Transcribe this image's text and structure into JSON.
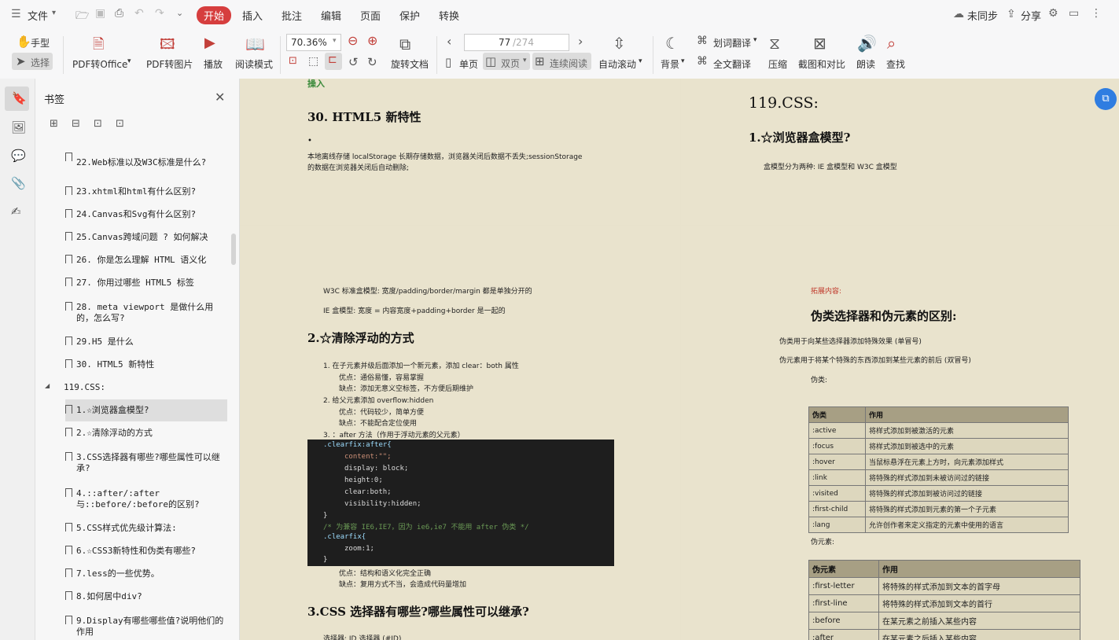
{
  "menubar": {
    "file": "文件",
    "tabs": [
      "开始",
      "插入",
      "批注",
      "编辑",
      "页面",
      "保护",
      "转换"
    ],
    "sync": "未同步",
    "share": "分享"
  },
  "ribbon": {
    "hand": "手型",
    "select": "选择",
    "pdf_office": "PDF转Office",
    "pdf_image": "PDF转图片",
    "play": "播放",
    "read_mode": "阅读模式",
    "zoom": "70.36%",
    "page_current": "77",
    "page_total": "/274",
    "rotate": "旋转文档",
    "single": "单页",
    "double": "双页",
    "continuous": "连续阅读",
    "autoscroll": "自动滚动",
    "background": "背景",
    "word_translate": "划词翻译",
    "full_translate": "全文翻译",
    "compress": "压缩",
    "screenshot": "截图和对比",
    "read_aloud": "朗读",
    "find": "查找"
  },
  "panel": {
    "title": "书签",
    "items": [
      {
        "label": "22.Web标准以及W3C标准是什么?"
      },
      {
        "label": "23.xhtml和html有什么区别?"
      },
      {
        "label": "24.Canvas和Svg有什么区别?"
      },
      {
        "label": "25.Canvas跨域问题 ? 如何解决"
      },
      {
        "label": "26. 你是怎么理解 HTML 语义化"
      },
      {
        "label": "27. 你用过哪些 HTML5 标签"
      },
      {
        "label": "28. meta viewport 是做什么用的，怎么写?"
      },
      {
        "label": "29.H5 是什么"
      },
      {
        "label": "30. HTML5 新特性"
      },
      {
        "label": "1.☆浏览器盒模型?"
      },
      {
        "label": "2.☆清除浮动的方式"
      },
      {
        "label": "3.CSS选择器有哪些?哪些属性可以继承?"
      },
      {
        "label": "4.::after/:after与::before/:before的区别?"
      },
      {
        "label": "5.CSS样式优先级计算法:"
      },
      {
        "label": "6.☆CSS3新特性和伪类有哪些?"
      },
      {
        "label": "7.less的一些优势。"
      },
      {
        "label": "8.如何居中div?"
      },
      {
        "label": "9.Display有哪些哪些值?说明他们的作用"
      }
    ],
    "section": "119.CSS:"
  },
  "doc": {
    "top_left": {
      "cut": "操入",
      "h30": "30.  HTML5  新特性",
      "bullet": "•",
      "line1": "本地离线存储  localStorage  长期存储数据，浏览器关闭后数据不丢失;sessionStorage",
      "line2": "的数据在浏览器关闭后自动删除;"
    },
    "top_right": {
      "h119": "119.CSS:",
      "h1": "1.☆浏览器盒模型?",
      "p": "盒模型分为两种: IE 盒模型和 W3C 盒模型"
    },
    "bottom_left": {
      "w3c": "W3C 标准盒模型:  宽度/padding/border/margin 都是单独分开的",
      "ie": "IE 盒模型:  宽度 = 内容宽度+padding+border  是一起的",
      "h2": "2.☆清除浮动的方式",
      "l1": "1. 在子元素并级后面添加一个新元素，添加 clear：both 属性",
      "l1a": "优点：通俗易懂，容易掌握",
      "l1b": "缺点：添加无意义空标签，不方便后期维护",
      "l2": "2. 给父元素添加 overflow:hidden",
      "l2a": "优点：代码较少，简单方便",
      "l2b": "缺点：不能配合定位使用",
      "l3": "3. ：after 方法（作用于浮动元素的父元素）",
      "code": [
        ".clearfix:after{",
        "content:\"\";",
        "display: block;",
        "height:0;",
        "clear:both;",
        "visibility:hidden;",
        "}",
        "/* 为兼容 IE6,IE7，因为 ie6,ie7 不能用 after 伪类 */",
        ".clearfix{",
        "zoom:1;",
        "}"
      ],
      "l3a": "优点：结构和语义化完全正确",
      "l3b": "缺点：复用方式不当，会造成代码量增加",
      "h3": "3.CSS 选择器有哪些?哪些属性可以继承?",
      "sel": "选择器: ID 选择器 (#ID)"
    },
    "bottom_right": {
      "extend": "拓展内容:",
      "h": "伪类选择器和伪元素的区别:",
      "p1": "伪类用于向某些选择器添加特殊效果 (单冒号)",
      "p2": "伪元素用于将某个特殊的东西添加到某些元素的前后 (双冒号)",
      "pseudo_class": "伪类:",
      "table1": {
        "headers": [
          "伪类",
          "作用"
        ],
        "rows": [
          [
            ":active",
            "将样式添加到被激活的元素"
          ],
          [
            ":focus",
            "将样式添加到被选中的元素"
          ],
          [
            ":hover",
            "当鼠标悬浮在元素上方时，向元素添加样式"
          ],
          [
            ":link",
            "将特殊的样式添加到未被访问过的链接"
          ],
          [
            ":visited",
            "将特殊的样式添加到被访问过的链接"
          ],
          [
            ":first-child",
            "将特殊的样式添加到元素的第一个子元素"
          ],
          [
            ":lang",
            "允许创作者来定义指定的元素中使用的语言"
          ]
        ]
      },
      "pseudo_element": "伪元素:",
      "table2": {
        "headers": [
          "伪元素",
          "作用"
        ],
        "rows": [
          [
            ":first-letter",
            "将特殊的样式添加到文本的首字母"
          ],
          [
            ":first-line",
            "将特殊的样式添加到文本的首行"
          ],
          [
            ":before",
            "在某元素之前插入某些内容"
          ],
          [
            ":after",
            "在某元素之后插入某些内容"
          ]
        ]
      }
    }
  }
}
